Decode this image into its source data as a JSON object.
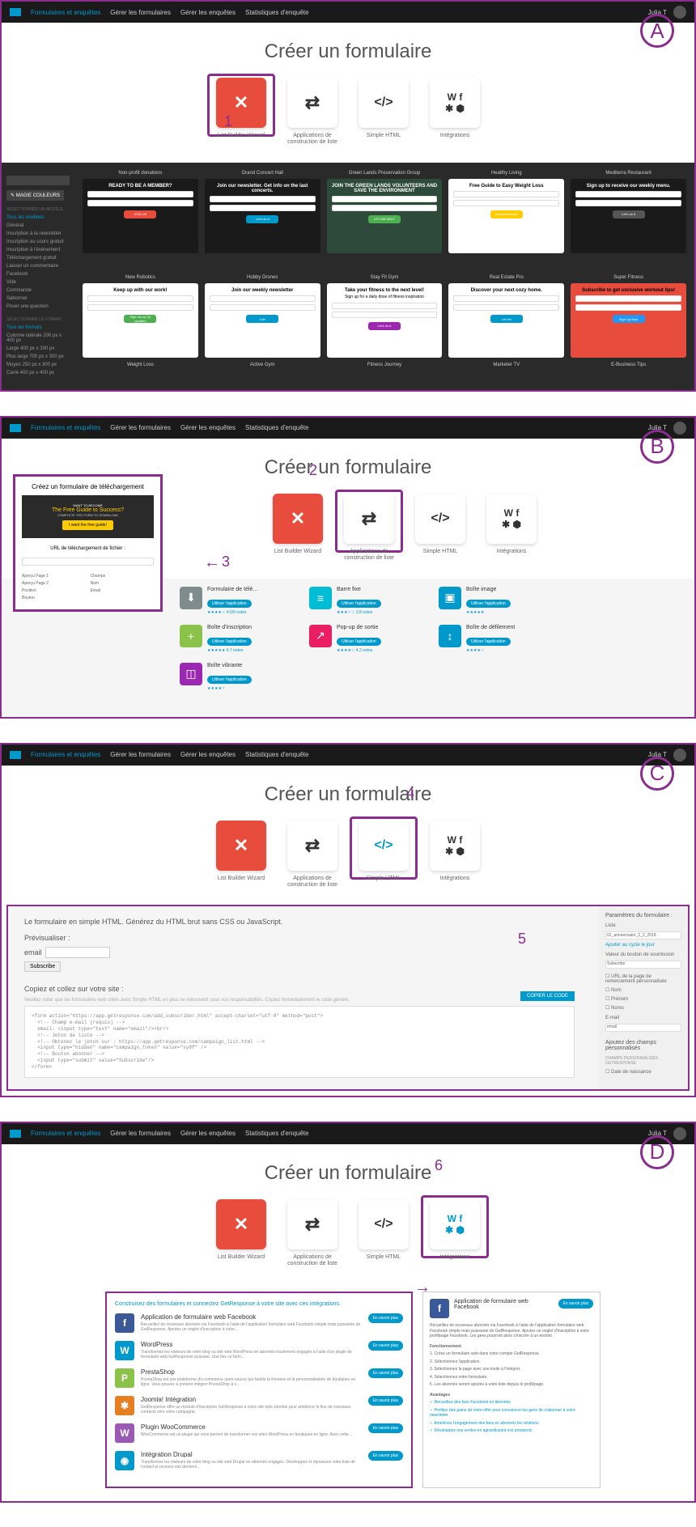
{
  "nav": {
    "menu": "Formulaires et enquêtes",
    "sub1": "Gérer les formulaires",
    "sub2": "Gérer les enquêtes",
    "sub3": "Statistiques d'enquête",
    "user": "Julia T"
  },
  "title": "Créer un formulaire",
  "tiles": [
    {
      "label": "List Builder Wizard",
      "icon": "✕"
    },
    {
      "label": "Applications de construction de liste",
      "icon": "⇄"
    },
    {
      "label": "Simple HTML",
      "icon": "</>"
    },
    {
      "label": "Intégrations",
      "icon": "W f"
    }
  ],
  "sidebar": {
    "magie": "✎ MAGIE COULEURS",
    "filter_hdr": "SÉLECTIONNER UN MODÈLE",
    "all": "Tous les modèles",
    "items": [
      "Général",
      "Inscription à la newsletter",
      "Inscription au cours gratuit",
      "Inscription à l'événement",
      "Téléchargement gratuit",
      "Laisser un commentaire",
      "Facebook",
      "Vide",
      "Commande",
      "Sabonner",
      "Poser une question"
    ],
    "format_hdr": "SÉLECTIONNER LE FORMAT",
    "all_formats": "Tous les formats",
    "formats": [
      "Colonne latérale 200 px x 400 px",
      "Large 400 px x 300 px",
      "Plus large 700 px x 300 px",
      "Moyen 250 px x 300 px",
      "Carré 400 px x 400 px"
    ]
  },
  "galleryA": {
    "row1": [
      {
        "hdr": "Non-profit donations",
        "title": "READY TO BE A MEMBER?",
        "btn": "JOIN US",
        "btncolor": "#e74c3c",
        "dark": true
      },
      {
        "hdr": "Grand Concert Hall",
        "title": "Join our newsletter. Get info on the last concerts.",
        "btn": "Let's do it",
        "btncolor": "#0099cc",
        "dark": true
      },
      {
        "hdr": "Green Lands Preservation Group",
        "title": "JOIN THE GREEN LANDS VOLUNTEERS AND SAVE THE ENVIRONMENT",
        "btn": "LET ME HELP",
        "btncolor": "#4caf50",
        "dark": true,
        "bg": "#2d4a3a"
      },
      {
        "hdr": "Healthy Living",
        "title": "Free Guide to Easy Weight Loss",
        "btn": "Download Now!",
        "btncolor": "#ffcc00",
        "dark": false
      },
      {
        "hdr": "Mediterra Restaurant",
        "title": "Sign up to receive our weekly menu.",
        "btn": "Let's do it",
        "btncolor": "#555",
        "dark": true
      }
    ],
    "row2": [
      {
        "hdr": "New Robotics",
        "title": "Keep up with our work!",
        "btn": "Sign me up for updates",
        "btncolor": "#4caf50",
        "dark": false
      },
      {
        "hdr": "Hobby Drones",
        "title": "Join our weekly newsletter",
        "btn": "Join",
        "btncolor": "#0099cc",
        "dark": false
      },
      {
        "hdr": "Stay Fit Gym",
        "title": "Take your fitness to the next level!",
        "sub": "Sign up for a daily dose of fitness inspiration",
        "btn": "Let's do it",
        "btncolor": "#9c27b0",
        "dark": false
      },
      {
        "hdr": "Real Estate Pro",
        "title": "Discover your next cozy home.",
        "btn": "Let me",
        "btncolor": "#0099cc",
        "dark": false
      },
      {
        "hdr": "Super Fitness",
        "title": "Subscribe to get exclusive workout tips!",
        "btn": "Sign Up Now",
        "btncolor": "#2196f3",
        "dark": false,
        "bg": "#e74c3c"
      }
    ],
    "row3": [
      "Weight Loss",
      "Active Gym",
      "Fitness Journey",
      "Marketer TV",
      "E-Business Tips"
    ]
  },
  "panelB": {
    "preview": {
      "hdr": "Créez un formulaire de téléchargement",
      "banner_top": "WANT TO BECOME",
      "banner_title": "The Free Guide to Success?",
      "banner_sub": "COMPLETE THE FORM TO DOWNLOAD",
      "banner_btn": "I want the free guide!",
      "url": "URL de téléchargement de fichier :"
    },
    "apps": [
      {
        "name": "Formulaire de télé…",
        "color": "#7f8c8d",
        "icon": "⬇",
        "stars": "★★★★☆ 4.5/5 notes"
      },
      {
        "name": "Barre fixe",
        "color": "#00bcd4",
        "icon": "≡",
        "stars": "★★★☆☆ 3.8 notes"
      },
      {
        "name": "Boîte image",
        "color": "#0099cc",
        "icon": "▣",
        "stars": "★★★★★"
      },
      {
        "name": "Boîte d'inscription",
        "color": "#8bc34a",
        "icon": "+",
        "stars": "★★★★★ 4.7 notes"
      },
      {
        "name": "Pop-up de sortie",
        "color": "#e91e63",
        "icon": "↗",
        "stars": "★★★★☆ 4.2 notes"
      },
      {
        "name": "Boîte de défilement",
        "color": "#0099cc",
        "icon": "↕",
        "stars": "★★★★☆"
      },
      {
        "name": "Boîte vibrante",
        "color": "#9c27b0",
        "icon": "◫",
        "stars": "★★★★☆"
      }
    ],
    "pill": "Utiliser l'application"
  },
  "panelC": {
    "desc": "Le formulaire en simple HTML. Générez du HTML brut sans CSS ou JavaScript.",
    "prev": "Prévisualiser :",
    "email": "email",
    "subscribe": "Subscribe",
    "copy": "Copiez et collez sur votre site :",
    "note": "Veuillez noter que les formulaires web créés avec Simple HTML en plus se retrouvent sous vos responsabilités. Copiez immédiatement le code généré.",
    "copybtn": "COPIER LE CODE",
    "code": "<form action=\"https://app.getresponse.com/add_subscriber.html\" accept-charset=\"utf-8\" method=\"post\">\n  <!-- Champ e-mail (requis) -->\n  email: <input type=\"text\" name=\"email\"/><br/>\n  <!-- Jeton de liste -->\n  <!-- Obtenez le jeton sur : https://app.getresponse.com/campaign_list.html -->\n  <input type=\"hidden\" name=\"campaign_token\" value=\"sy8f\" />\n  <!-- Bouton abonner -->\n  <input type=\"submit\" value=\"Subscribe\"/>\n</form>",
    "settings": {
      "hdr": "Paramètres du formulaire :",
      "liste": "Liste",
      "liste_val": "01_anniversaire_2_3_2018",
      "cycle": "Ajouter au cycle le jour",
      "valeur": "Valeur du bouton de soumission",
      "valeur_val": "Subscribe",
      "url": "URL de la page de remerciement personnalisée",
      "nom": "Nom",
      "prenom": "Prénom",
      "noms": "Noms",
      "email": "E-mail",
      "email_val": "email",
      "ajoutez": "Ajoutez des champs personnalisés",
      "champs": "CHAMPS PERSONNALISÉS GETRESPONSE",
      "date": "Date de naissance"
    }
  },
  "panelD": {
    "hdr": "Construisez des formulaires et connectez GetResponse à votre site avec ces intégrations.",
    "btn": "En savoir plus",
    "items": [
      {
        "name": "Application de formulaire web Facebook",
        "desc": "Recueillez de nouveaux abonnés via Facebook à l'aide de l'application formulaire web Facebook simple mais puissante de GetResponse. Ajoutez un onglet d'inscription à votre…",
        "color": "#3b5998",
        "icon": "f"
      },
      {
        "name": "WordPress",
        "desc": "Transformez les visiteurs de votre blog ou site web WordPress en abonnés hautement engagés à l'aide d'un plugin de formulaire web GetResponse puissant. Une fois ce form…",
        "color": "#0099cc",
        "icon": "W"
      },
      {
        "name": "PrestaShop",
        "desc": "PrestaShop est une plateforme d'e-commerce open-source qui facilite la livraison et la personnalisation de boutiques en ligne. Vous pouvez à présent intégrer PrestaShop à v…",
        "color": "#8bc34a",
        "icon": "P"
      },
      {
        "name": "Joomla! Intégration",
        "desc": "GetResponse offre un module d'inscription GetResponse à votre site web Joomla! pour améliorer le flux de nouveaux contacts vers votre campagne.",
        "color": "#e67e22",
        "icon": "✱"
      },
      {
        "name": "Plugin WooCommerce",
        "desc": "WooCommerce est un plugin qui vous permet de transformer vos sites WordPress en boutiques en ligne. Avec cette…",
        "color": "#9b59b6",
        "icon": "W"
      },
      {
        "name": "Intégration Drupal",
        "desc": "Transformez les visiteurs de votre blog ou site web Drupal en abonnés engagés. Développez et réjouissez votre liste de contact et recevez vos derniers…",
        "color": "#0099cc",
        "icon": "◉"
      }
    ],
    "detail": {
      "title": "Application de formulaire web Facebook",
      "desc": "Recueillez de nouveaux abonnés via Facebook à l'aide de l'application formulaire web Facebook simple mais puissante de GetResponse. Ajoutez un onglet d'inscription à votre profil/page Facebook. Les gens pourront alors s'inscrire à un endroit.",
      "fonc": "Fonctionnement",
      "f1": "1. Créez un formulaire web dans votre compte GetResponse.",
      "f2": "2. Sélectionnez l'application.",
      "f3": "3. Sélectionnez la page avec une invite à l'intégrer.",
      "f4": "4. Sélectionnez votre formulaire.",
      "f5": "5. Les abonnés seront ajoutés à votre liste depuis le profil/page.",
      "av": "Avantages",
      "a1": "✓ Recueillez des fans Facebook en abonnés",
      "a2": "✓ Profitez des gains de votre offre pour convaincre les gens de s'abonner à votre newsletter",
      "a3": "✓ Améliorez l'engagement des fans en abonnés les relations",
      "a4": "✓ Développez vos ventes en agrandissant vos prospects"
    }
  }
}
